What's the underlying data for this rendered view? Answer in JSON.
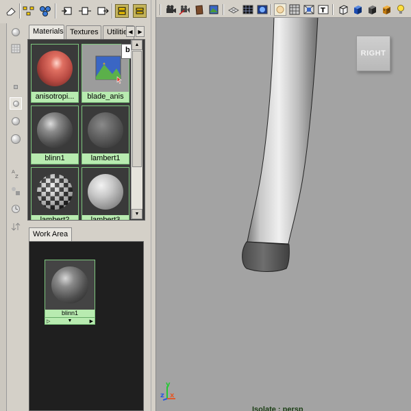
{
  "hypershade": {
    "tabs": [
      {
        "label": "Materials",
        "active": true
      },
      {
        "label": "Textures",
        "active": false
      },
      {
        "label": "Utilitie",
        "active": false
      }
    ],
    "swatches": [
      {
        "label": "anisotropi...",
        "type": "anisotropic"
      },
      {
        "label": "blade_anis",
        "type": "texture"
      },
      {
        "label": "blinn1",
        "type": "blinn"
      },
      {
        "label": "lambert1",
        "type": "lambert"
      },
      {
        "label": "lambert2",
        "type": "checker"
      },
      {
        "label": "lambert3",
        "type": "lambert-light"
      }
    ],
    "tooltip_fragment": "b"
  },
  "work_area": {
    "tab_label": "Work Area",
    "swatch_label": "blinn1"
  },
  "viewport": {
    "view_cube_label": "RIGHT",
    "isolate_text": "Isolate : persp",
    "axis": {
      "y": "y",
      "z": "z",
      "x": "x"
    },
    "colors": {
      "background": "#a3a3a3",
      "axis_x": "#e05a2a",
      "axis_y": "#22c832",
      "axis_z": "#2a5ae0"
    }
  }
}
